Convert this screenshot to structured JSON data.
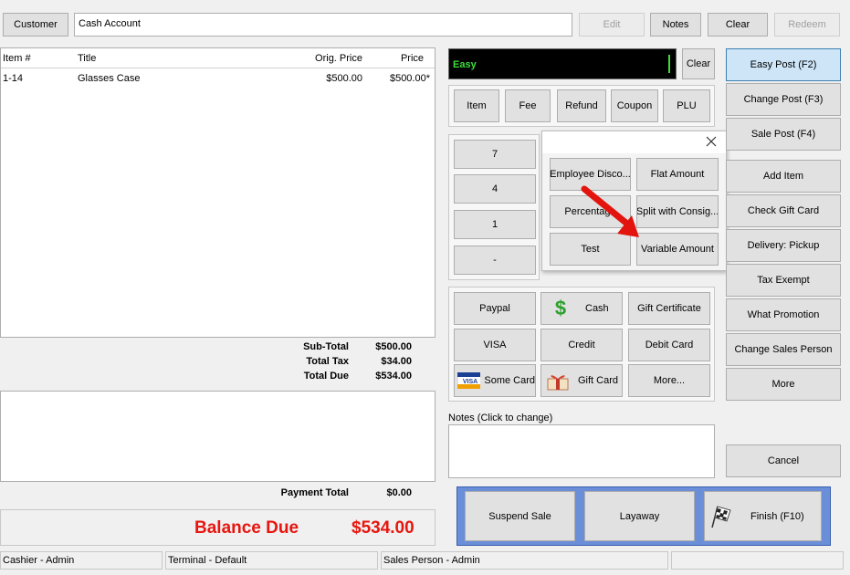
{
  "top": {
    "customer_label": "Customer",
    "account": "Cash Account",
    "edit": "Edit",
    "notes": "Notes",
    "clear": "Clear",
    "redeem": "Redeem"
  },
  "table": {
    "headers": [
      "Item #",
      "Title",
      "Orig. Price",
      "Price"
    ],
    "rows": [
      {
        "item": "1-14",
        "title": "Glasses Case",
        "orig": "$500.00",
        "price": "$500.00*"
      }
    ]
  },
  "totals": {
    "subtotal_label": "Sub-Total",
    "subtotal": "$500.00",
    "tax_label": "Total Tax",
    "tax": "$34.00",
    "due_label": "Total Due",
    "due": "$534.00",
    "payment_label": "Payment Total",
    "payment": "$0.00",
    "balance_label": "Balance Due",
    "balance": "$534.00"
  },
  "entry": {
    "mode": "Easy",
    "clear": "Clear"
  },
  "types": [
    "Item",
    "Fee",
    "Refund",
    "Coupon",
    "PLU"
  ],
  "keypad": [
    "7",
    "4",
    "1",
    "-"
  ],
  "popup": {
    "items": [
      "Employee Disco...",
      "Flat Amount",
      "Percentage",
      "Split with Consig...",
      "Test",
      "Variable Amount"
    ]
  },
  "payments": [
    "Paypal",
    "Cash",
    "Gift Certificate",
    "VISA",
    "Credit",
    "Debit Card",
    "Some Card",
    "Gift Card",
    "More..."
  ],
  "notes": {
    "label": "Notes (Click to change)"
  },
  "right_buttons": [
    "Easy Post (F2)",
    "Change Post (F3)",
    "Sale Post (F4)",
    "Add Item",
    "Check Gift Card",
    "Delivery: Pickup",
    "Tax Exempt",
    "What Promotion",
    "Change Sales Person",
    "More"
  ],
  "cancel": "Cancel",
  "bottom_buttons": [
    "Suspend Sale",
    "Layaway",
    "Finish (F10)"
  ],
  "status": {
    "cashier": "Cashier - Admin",
    "terminal": "Terminal - Default",
    "salesperson": "Sales Person - Admin"
  },
  "colors": {
    "balance": "#e8150f",
    "accent_blue": "#6a8fd8",
    "entry_bg": "#000000",
    "entry_text": "#3cdc3c",
    "arrow": "#e3140e"
  }
}
